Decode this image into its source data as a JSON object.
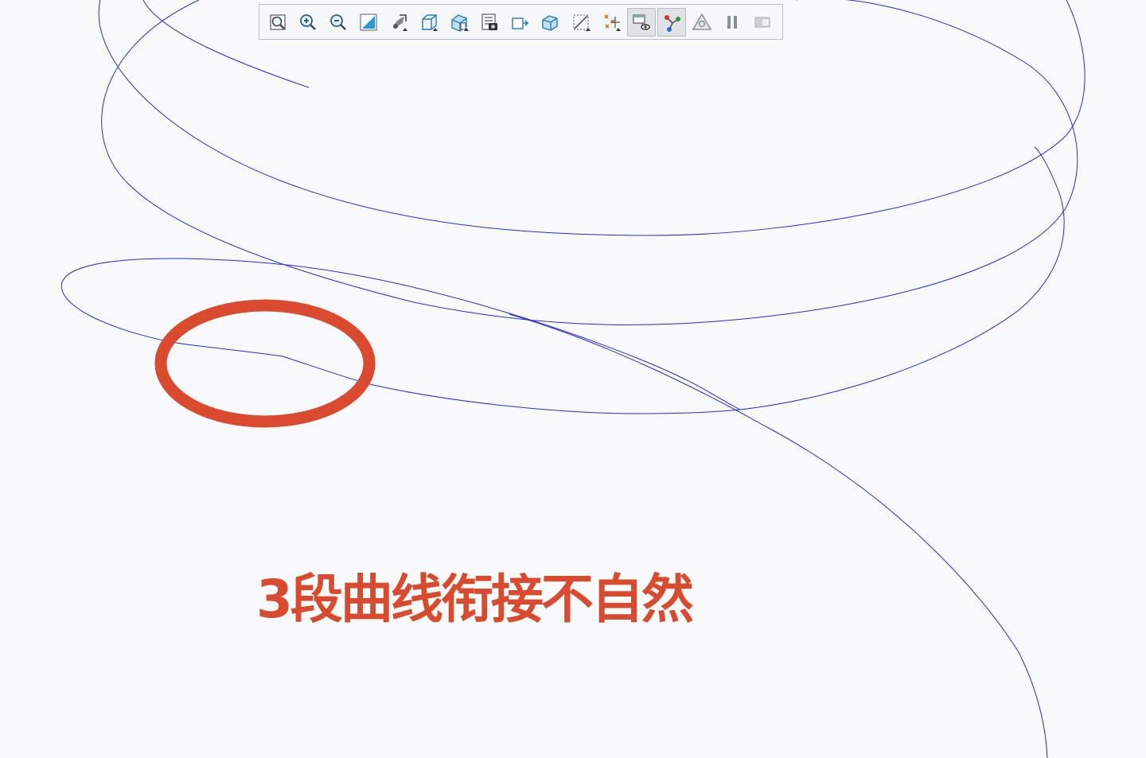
{
  "toolbar": {
    "buttons": [
      {
        "icon": "zoom-fit-icon",
        "active": false
      },
      {
        "icon": "zoom-in-icon",
        "active": false
      },
      {
        "icon": "zoom-out-icon",
        "active": false
      },
      {
        "icon": "repaint-icon",
        "active": false
      },
      {
        "icon": "reorient-icon",
        "active": false
      },
      {
        "icon": "saved-orientation-icon",
        "active": false
      },
      {
        "icon": "display-style-icon",
        "active": false
      },
      {
        "icon": "view-manager-icon",
        "active": false
      },
      {
        "icon": "perspective-view-icon",
        "active": false
      },
      {
        "icon": "section-view-icon",
        "active": false
      },
      {
        "icon": "annotation-display-icon",
        "active": false
      },
      {
        "icon": "datum-display-filter-icon",
        "active": false
      },
      {
        "icon": "spin-center-icon",
        "active": true
      },
      {
        "icon": "tree-display-icon",
        "active": true
      },
      {
        "icon": "appearance-icon",
        "active": false
      },
      {
        "icon": "pause-icon",
        "active": false
      },
      {
        "icon": "next-step-icon",
        "active": false
      }
    ]
  },
  "annotation": {
    "caption": "3段曲线衔接不自然",
    "highlight_color": "#d94a2e"
  },
  "curves": {
    "color": "#2b2bd6"
  }
}
